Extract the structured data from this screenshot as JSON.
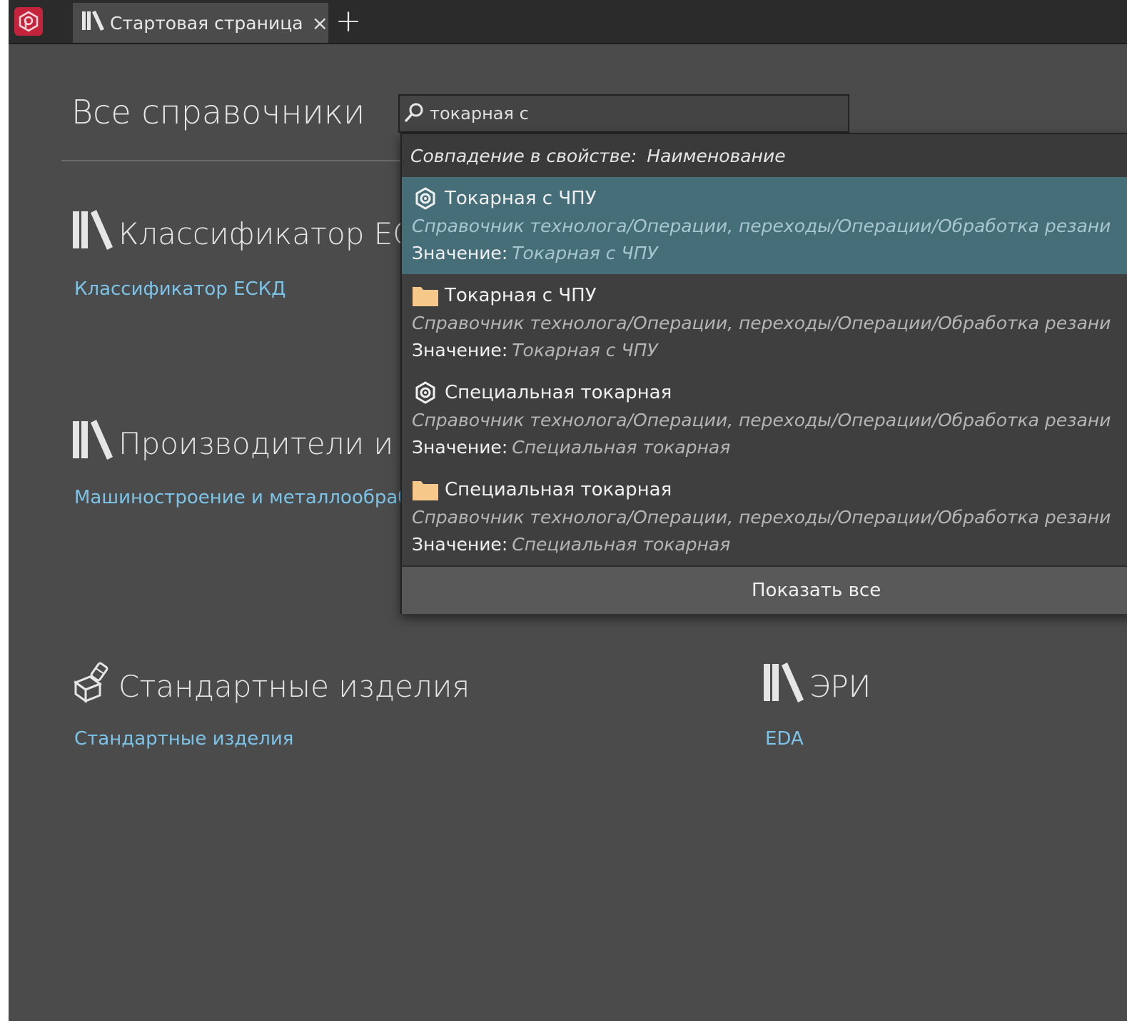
{
  "tabs": [
    {
      "label": "Стартовая страница",
      "close_label": "×"
    }
  ],
  "add_tab_label": "+",
  "page": {
    "title": "Все справочники"
  },
  "search": {
    "value": "токарная с",
    "placeholder": ""
  },
  "sections": [
    {
      "heading": "Классификатор ЕСКД",
      "link": "Классификатор ЕСКД",
      "icon": "library-icon"
    },
    {
      "heading": "Производители и по",
      "link": "Машиностроение и металлообраб",
      "icon": "library-icon"
    },
    {
      "heading": "Стандартные изделия",
      "link": "Стандартные изделия",
      "icon": "standard-parts-icon"
    },
    {
      "heading": "ЭРИ",
      "link": "EDA",
      "icon": "library-icon"
    }
  ],
  "dropdown": {
    "header_prefix": "Совпадение в свойстве:",
    "header_property": "Наименование",
    "value_label": "Значение:",
    "items": [
      {
        "icon": "operation-icon",
        "name": "Токарная с ЧПУ",
        "path": "Справочник технолога/Операции, переходы/Операции/Обработка резани",
        "value": "Токарная с ЧПУ",
        "selected": true
      },
      {
        "icon": "folder-icon",
        "name": "Токарная с ЧПУ",
        "path": "Справочник технолога/Операции, переходы/Операции/Обработка резани",
        "value": "Токарная с ЧПУ",
        "selected": false
      },
      {
        "icon": "operation-icon",
        "name": "Специальная токарная",
        "path": "Справочник технолога/Операции, переходы/Операции/Обработка резани",
        "value": "Специальная токарная",
        "selected": false
      },
      {
        "icon": "folder-icon",
        "name": "Специальная токарная",
        "path": "Справочник технолога/Операции, переходы/Операции/Обработка резани",
        "value": "Специальная токарная",
        "selected": false
      }
    ],
    "show_all": "Показать все"
  },
  "colors": {
    "background": "#4b4b4b",
    "titlebar": "#2b2b2b",
    "selected_item": "#456e78",
    "link": "#7cc3e8",
    "logo": "#c4243b",
    "folder": "#f6c98a"
  }
}
